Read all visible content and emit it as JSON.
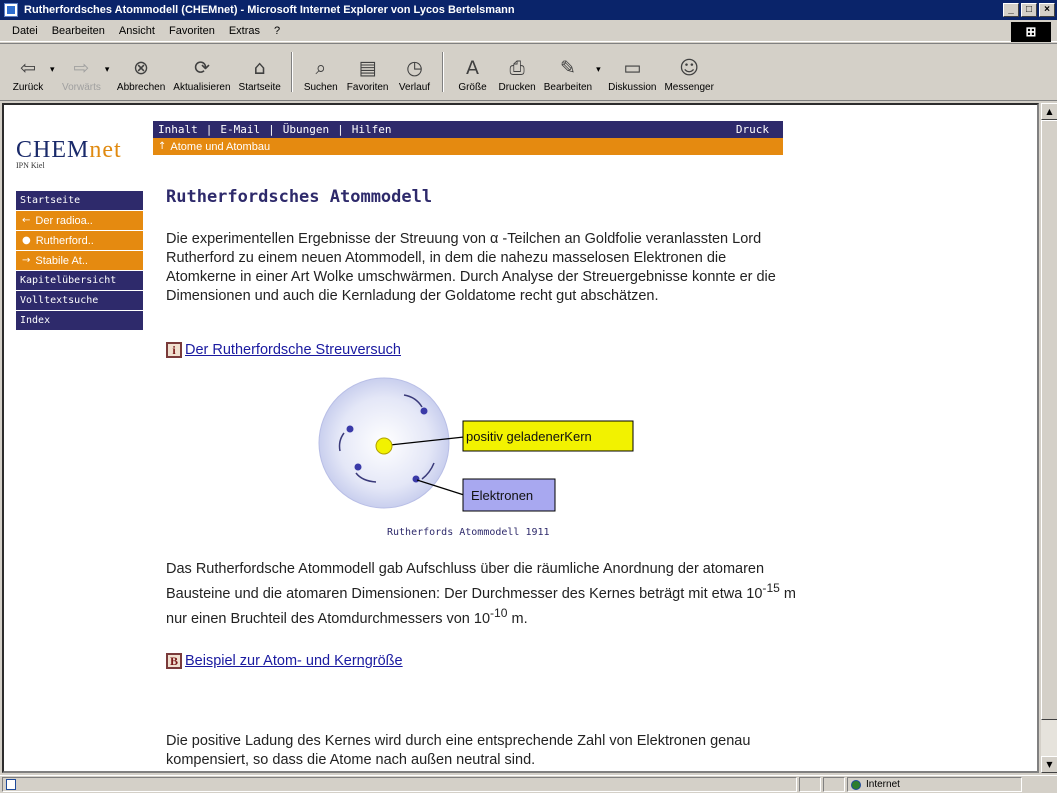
{
  "window": {
    "title": "Rutherfordsches Atommodell (CHEMnet) - Microsoft Internet Explorer von Lycos Bertelsmann",
    "controls": [
      "_",
      "□",
      "×"
    ]
  },
  "menu": [
    "Datei",
    "Bearbeiten",
    "Ansicht",
    "Favoriten",
    "Extras",
    "?"
  ],
  "toolbar": [
    {
      "label": "Zurück",
      "icon": "⇦",
      "name": "back"
    },
    {
      "label": "Vorwärts",
      "icon": "⇨",
      "name": "forward"
    },
    {
      "label": "Abbrechen",
      "icon": "⊗",
      "name": "stop"
    },
    {
      "label": "Aktualisieren",
      "icon": "⟳",
      "name": "refresh"
    },
    {
      "label": "Startseite",
      "icon": "⌂",
      "name": "home"
    },
    {
      "label": "Suchen",
      "icon": "⌕",
      "name": "search"
    },
    {
      "label": "Favoriten",
      "icon": "▤",
      "name": "favorites"
    },
    {
      "label": "Verlauf",
      "icon": "◷",
      "name": "history"
    },
    {
      "label": "Größe",
      "icon": "A",
      "name": "size"
    },
    {
      "label": "Drucken",
      "icon": "⎙",
      "name": "print"
    },
    {
      "label": "Bearbeiten",
      "icon": "✎",
      "name": "edit"
    },
    {
      "label": "Diskussion",
      "icon": "▭",
      "name": "discuss"
    },
    {
      "label": "Messenger",
      "icon": "☺",
      "name": "messenger"
    }
  ],
  "site": {
    "logo": {
      "prefix": "CHEM",
      "suffix": "net"
    },
    "logo_sub": "IPN Kiel",
    "topnav": [
      "Inhalt",
      "E-Mail",
      "Übungen",
      "Hilfen"
    ],
    "topnav_druck": "Druck",
    "crumb": "Atome und Atombau",
    "sidebar": {
      "startseite": "Startseite",
      "sub1": "Der radioa..",
      "sub2": "Rutherford..",
      "sub3": "Stabile At..",
      "kapitel": "Kapitelübersicht",
      "volltext": "Volltextsuche",
      "index": "Index"
    }
  },
  "content": {
    "heading": "Rutherfordsches Atommodell",
    "para1": "Die experimentellen Ergebnisse der Streuung von α -Teilchen an Goldfolie veranlassten Lord Rutherford zu einem neuen Atommodell, in dem die nahezu masselosen Elektronen die Atomkerne in einer Art Wolke umschwärmen. Durch Analyse der Streuergebnisse konnte er die Dimensionen und auch die Kernladung der Goldatome recht gut abschätzen.",
    "link1_box": "i",
    "link1": "Der Rutherfordsche Streuversuch",
    "figure": {
      "label_kern": "positiv geladenerKern",
      "label_elektronen": "Elektronen",
      "caption": "Rutherfords Atommodell 1911"
    },
    "para2_a": "Das Rutherfordsche Atommodell gab Aufschluss über die räumliche Anordnung der atomaren Bausteine und die atomaren Dimensionen: Der Durchmesser des Kernes beträgt mit etwa 10",
    "para2_exp1": "-15",
    "para2_b": " m nur einen Bruchteil des Atomdurchmessers von 10",
    "para2_exp2": "-10",
    "para2_c": " m.",
    "link2_box": "B",
    "link2": "Beispiel zur Atom- und Kerngröße",
    "para3": "Die positive Ladung des Kernes wird durch eine entsprechende Zahl von Elektronen genau kompensiert, so dass die Atome nach außen neutral sind."
  },
  "status": {
    "zone": "Internet"
  },
  "colors": {
    "navy": "#2e2a6b",
    "orange": "#e58a10",
    "kern_fill": "#f2f200",
    "elektronen_fill": "#a8a8f0",
    "atom_fill": "#dfe3f5"
  }
}
